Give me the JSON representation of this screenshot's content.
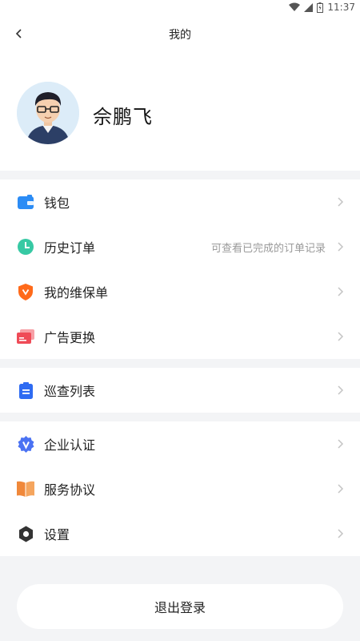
{
  "status": {
    "time": "11:37"
  },
  "nav": {
    "title": "我的"
  },
  "profile": {
    "name": "佘鹏飞"
  },
  "menu": {
    "wallet": {
      "label": "钱包",
      "icon": "wallet-icon",
      "color": "#2b8cf5"
    },
    "history": {
      "label": "历史订单",
      "hint": "可查看已完成的订单记录",
      "icon": "clock-icon",
      "color": "#37c9a4"
    },
    "maintenance": {
      "label": "我的维保单",
      "icon": "shield-icon",
      "color": "#ff6a1a"
    },
    "ad_replace": {
      "label": "广告更换",
      "icon": "ad-card-icon",
      "color": "#ef4b57"
    },
    "inspection": {
      "label": "巡查列表",
      "icon": "clipboard-icon",
      "color": "#2e6bf2"
    },
    "enterprise": {
      "label": "企业认证",
      "icon": "verified-badge-icon",
      "color": "#4a72f3"
    },
    "service": {
      "label": "服务协议",
      "icon": "book-icon",
      "color": "#f0883a"
    },
    "settings": {
      "label": "设置",
      "icon": "gear-icon",
      "color": "#333333"
    }
  },
  "logout": {
    "label": "退出登录"
  }
}
